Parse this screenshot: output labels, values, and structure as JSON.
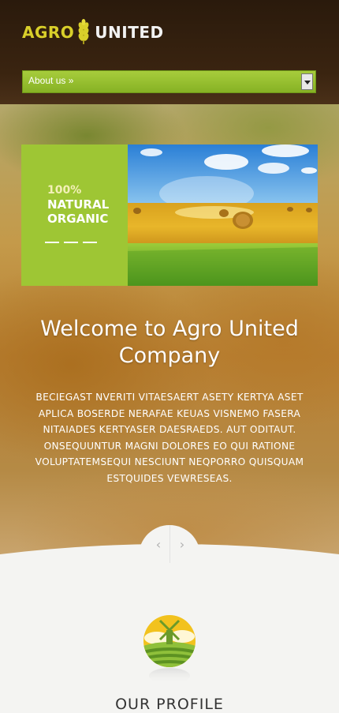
{
  "header": {
    "logo_word1": "AGRO",
    "logo_word2": "UNITED",
    "menu_label": "About us »"
  },
  "banner": {
    "line1": "100%",
    "line2": "NATURAL",
    "line3": "ORGANIC"
  },
  "hero": {
    "title_line1": "Welcome to Agro United",
    "title_line2": "Company",
    "body_lines": [
      "BECIEGAST NVERITI VITAESAERT ASETY KERTYA ASET",
      "APLICA BOSERDE NERAFAE KEUAS VISNEMO FASERA",
      "NITAIADES KERTYASER DAESRAEDS. AUT ODITAUT.",
      "ONSEQUUNTUR MAGNI DOLORES EO QUI RATIONE",
      "VOLUPTATEMSEQUI NESCIUNT NEQPORRO QUISQUAM",
      "ESTQUIDES VEWRESEAS."
    ]
  },
  "slider": {
    "prev_glyph": "‹",
    "next_glyph": "›"
  },
  "section": {
    "heading": "OUR PROFILE"
  },
  "colors": {
    "accent_green": "#9ec634",
    "logo_yellow": "#d9cf2a",
    "header_brown": "#2a1a0c"
  }
}
